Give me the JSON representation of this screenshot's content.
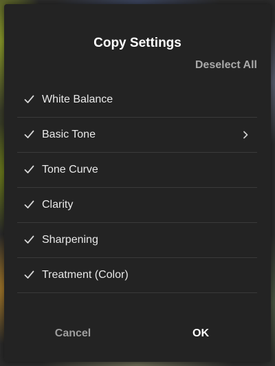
{
  "dialog": {
    "title": "Copy Settings",
    "deselect_label": "Deselect All",
    "items": [
      {
        "label": "White Balance",
        "checked": true,
        "has_submenu": false
      },
      {
        "label": "Basic Tone",
        "checked": true,
        "has_submenu": true
      },
      {
        "label": "Tone Curve",
        "checked": true,
        "has_submenu": false
      },
      {
        "label": "Clarity",
        "checked": true,
        "has_submenu": false
      },
      {
        "label": "Sharpening",
        "checked": true,
        "has_submenu": false
      },
      {
        "label": "Treatment (Color)",
        "checked": true,
        "has_submenu": false
      }
    ],
    "cancel_label": "Cancel",
    "ok_label": "OK"
  },
  "icons": {
    "check": "checkmark-icon",
    "submenu": "chevron-right-icon"
  },
  "colors": {
    "dialog_bg": "#232323",
    "divider": "#3a3a3a",
    "primary_text": "#ffffff",
    "secondary_text": "#a9a9a9"
  }
}
